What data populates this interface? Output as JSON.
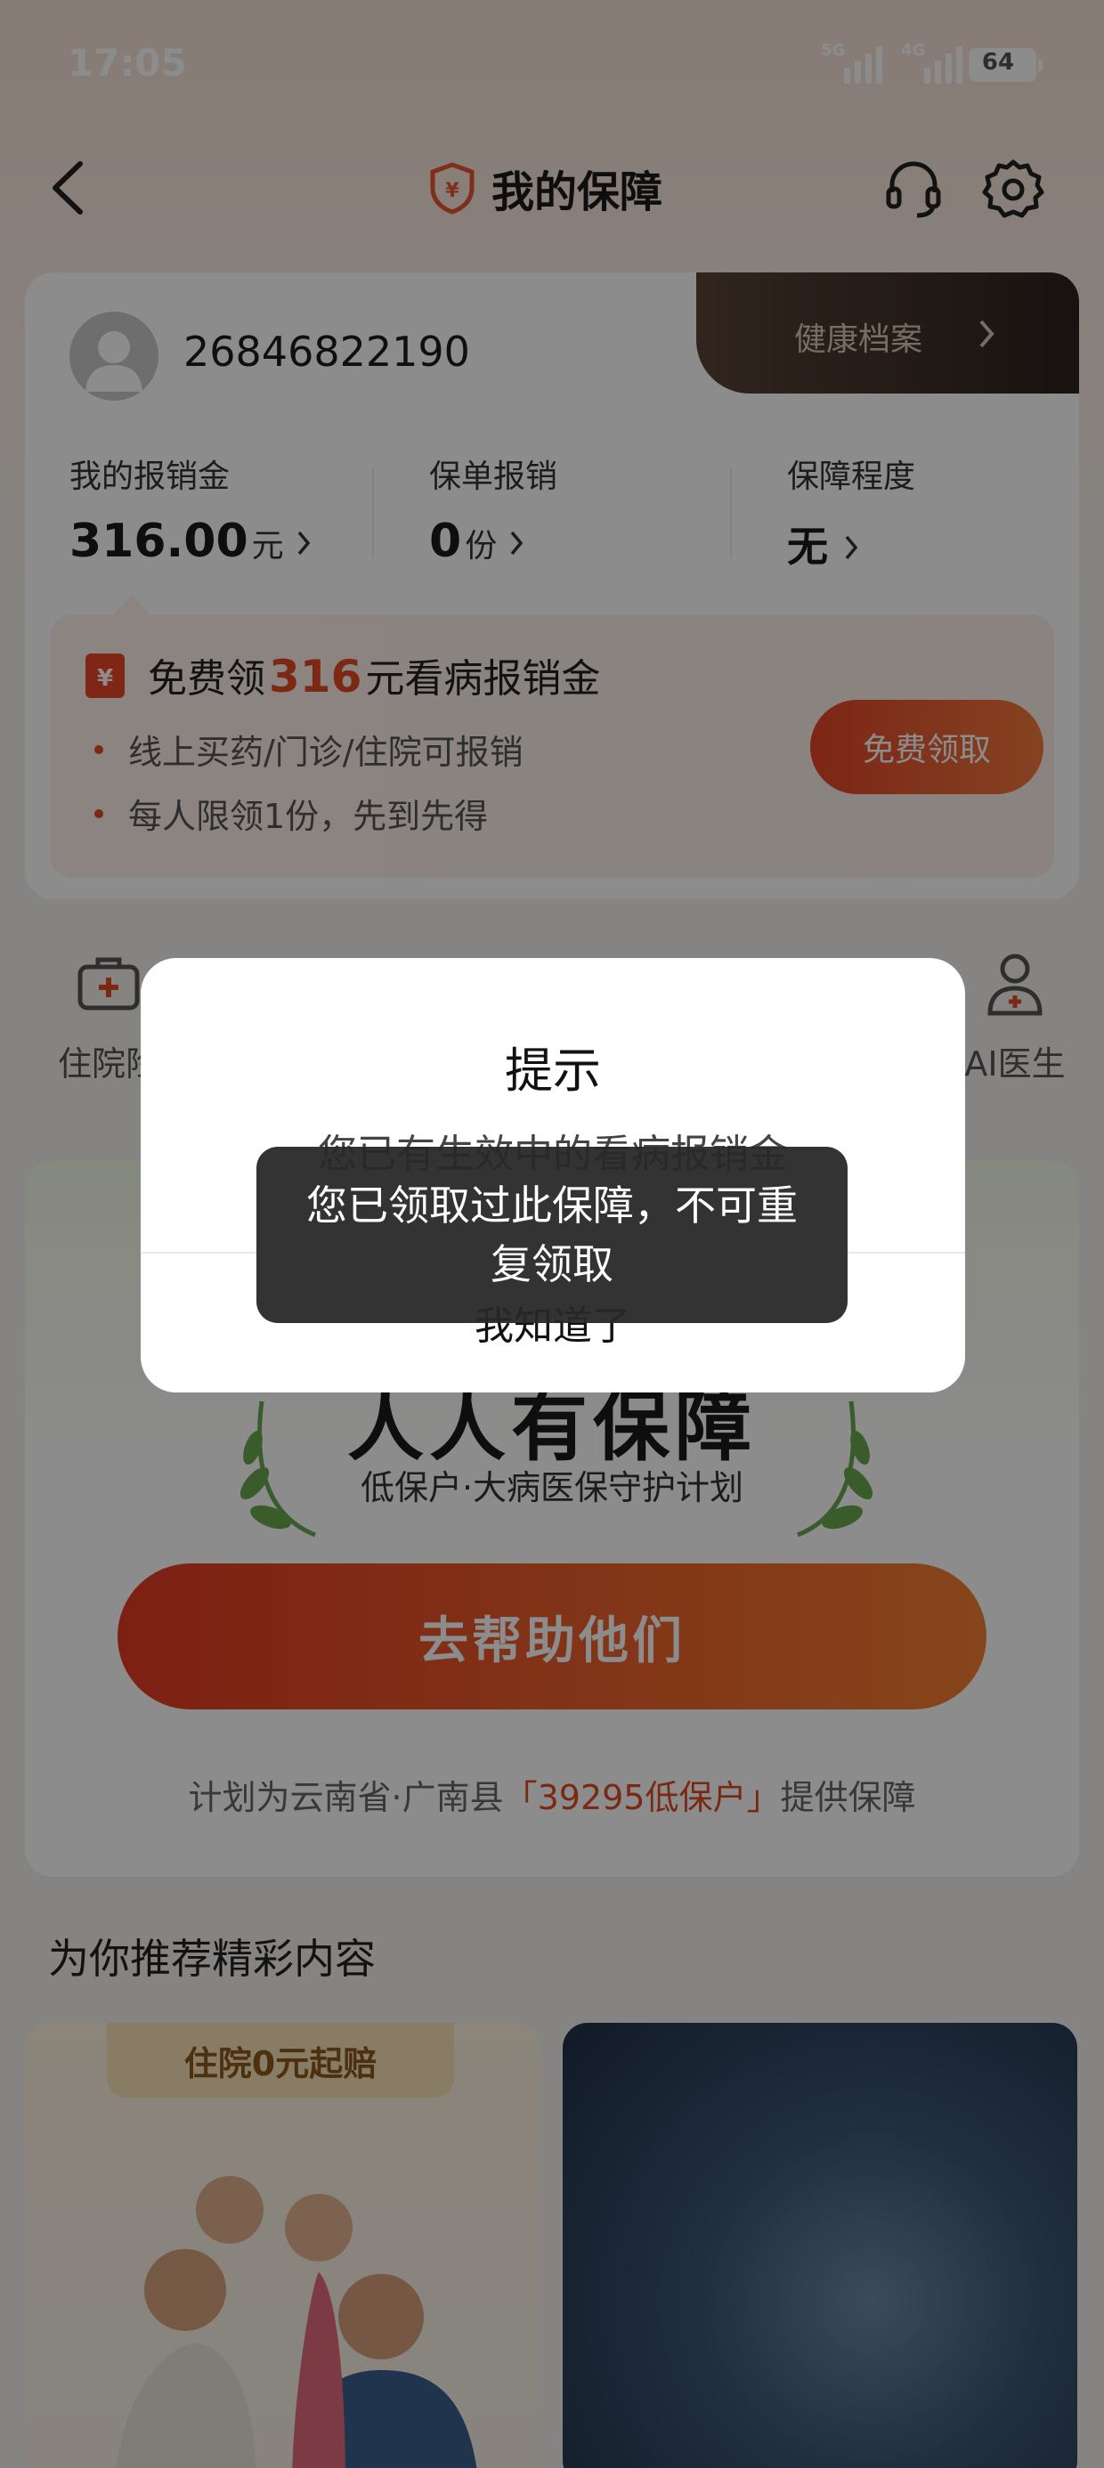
{
  "status_bar": {
    "time": "17:05",
    "sim1": "5G",
    "sim2": "4G",
    "battery": "64"
  },
  "nav": {
    "title": "我的保障"
  },
  "user": {
    "account": "26846822190",
    "health_link": "健康档案",
    "stats": [
      {
        "label": "我的报销金",
        "value": "316.00",
        "unit": "元"
      },
      {
        "label": "保单报销",
        "value": "0",
        "unit": "份"
      },
      {
        "label": "保障程度",
        "value": "无",
        "unit": ""
      }
    ]
  },
  "promo": {
    "title_prefix": "免费领",
    "amount": "316",
    "title_suffix": "元看病报销金",
    "bullets": [
      "线上买药/门诊/住院可报销",
      "每人限领1份，先到先得"
    ],
    "button": "免费领取"
  },
  "quick_links": [
    {
      "label": "住院险"
    },
    {
      "label": "AI医生"
    }
  ],
  "campaign": {
    "title": "人人有保障",
    "subtitle": "低保户·大病医保守护计划",
    "button": "去帮助他们",
    "foot_prefix": "计划为云南省·广南县",
    "foot_highlight": "「39295低保户」",
    "foot_suffix": "提供保障"
  },
  "recommend": {
    "title": "为你推荐精彩内容",
    "card1_badge": "住院0元起赔"
  },
  "dialog": {
    "title": "提示",
    "message": "您已有生效中的看病报销金",
    "button": "我知道了"
  },
  "toast": {
    "message": "您已领取过此保障，不可重复领取"
  },
  "colors": {
    "accent": "#e24a21",
    "dark_tab": "#2b2320",
    "mask": "rgba(0,0,0,0.45)"
  }
}
